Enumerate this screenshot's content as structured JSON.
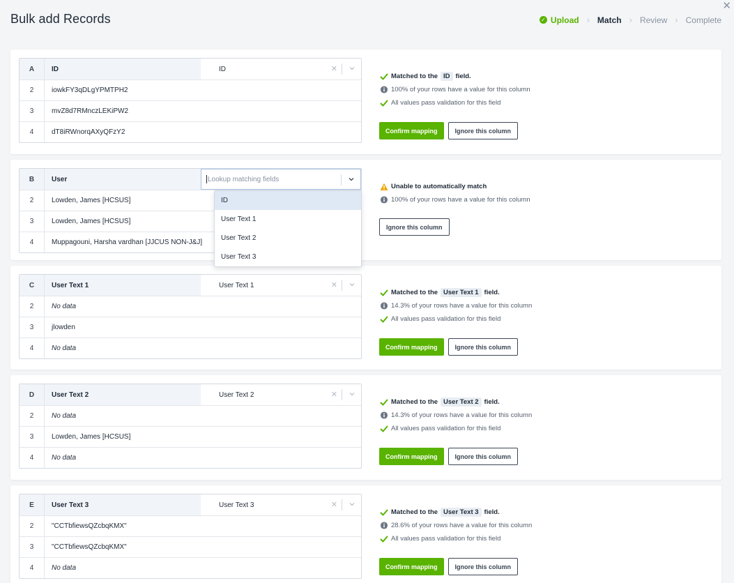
{
  "title": "Bulk add Records",
  "stepper": {
    "steps": [
      {
        "label": "Upload",
        "state": "done"
      },
      {
        "label": "Match",
        "state": "active"
      },
      {
        "label": "Review",
        "state": "pending"
      },
      {
        "label": "Complete",
        "state": "pending"
      }
    ]
  },
  "colors": {
    "accent": "#59b300",
    "warning": "#f0a500",
    "info": "#55606e"
  },
  "cards": [
    {
      "letter": "A",
      "header": "ID",
      "mapped": "ID",
      "rows": [
        {
          "n": "2",
          "v": "iowkFY3qDLgYPMTPH2"
        },
        {
          "n": "3",
          "v": "mvZ8d7RMnczLEKiPW2"
        },
        {
          "n": "4",
          "v": "dT8iRWnorqAXyQFzY2"
        }
      ],
      "status": {
        "matched_prefix": "Matched to the",
        "matched_field": "ID",
        "matched_suffix": "field.",
        "percent_text": "100% of your rows have a value for this column",
        "validation_text": "All values pass validation for this field"
      },
      "confirm_label": "Confirm mapping",
      "ignore_label": "Ignore this column"
    },
    {
      "letter": "B",
      "header": "User",
      "placeholder": "Lookup matching fields",
      "rows": [
        {
          "n": "2",
          "v": "Lowden, James [HCSUS]"
        },
        {
          "n": "3",
          "v": "Lowden, James [HCSUS]"
        },
        {
          "n": "4",
          "v": "Muppagouni, Harsha vardhan [JJCUS NON-J&J]"
        }
      ],
      "status": {
        "warning_text": "Unable to automatically match",
        "percent_text": "100% of your rows have a value for this column"
      },
      "ignore_label": "Ignore this column"
    },
    {
      "letter": "C",
      "header": "User Text 1",
      "mapped": "User Text 1",
      "rows": [
        {
          "n": "2",
          "v": "No data",
          "nodata": true
        },
        {
          "n": "3",
          "v": "jlowden"
        },
        {
          "n": "4",
          "v": "No data",
          "nodata": true
        }
      ],
      "status": {
        "matched_prefix": "Matched to the",
        "matched_field": "User Text 1",
        "matched_suffix": "field.",
        "percent_text": "14.3% of your rows have a value for this column",
        "validation_text": "All values pass validation for this field"
      },
      "confirm_label": "Confirm mapping",
      "ignore_label": "Ignore this column"
    },
    {
      "letter": "D",
      "header": "User Text 2",
      "mapped": "User Text 2",
      "rows": [
        {
          "n": "2",
          "v": "No data",
          "nodata": true
        },
        {
          "n": "3",
          "v": "Lowden, James [HCSUS]"
        },
        {
          "n": "4",
          "v": "No data",
          "nodata": true
        }
      ],
      "status": {
        "matched_prefix": "Matched to the",
        "matched_field": "User Text 2",
        "matched_suffix": "field.",
        "percent_text": "14.3% of your rows have a value for this column",
        "validation_text": "All values pass validation for this field"
      },
      "confirm_label": "Confirm mapping",
      "ignore_label": "Ignore this column"
    },
    {
      "letter": "E",
      "header": "User Text 3",
      "mapped": "User Text 3",
      "rows": [
        {
          "n": "2",
          "v": "\"CCTbfiewsQZcbqKMX\""
        },
        {
          "n": "3",
          "v": "\"CCTbfiewsQZcbqKMX\""
        },
        {
          "n": "4",
          "v": "No data",
          "nodata": true
        }
      ],
      "status": {
        "matched_prefix": "Matched to the",
        "matched_field": "User Text 3",
        "matched_suffix": "field.",
        "percent_text": "28.6% of your rows have a value for this column",
        "validation_text": "All values pass validation for this field"
      },
      "confirm_label": "Confirm mapping",
      "ignore_label": "Ignore this column"
    }
  ],
  "dropdown": {
    "options": [
      "ID",
      "User Text 1",
      "User Text 2",
      "User Text 3"
    ],
    "highlighted": "ID"
  }
}
